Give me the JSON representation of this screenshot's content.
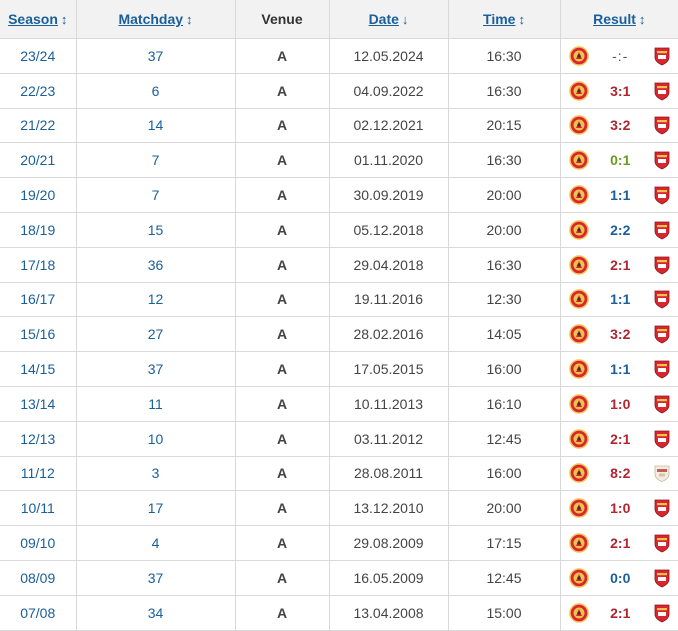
{
  "headers": {
    "season": "Season",
    "matchday": "Matchday",
    "venue": "Venue",
    "date": "Date",
    "time": "Time",
    "result": "Result"
  },
  "icons": {
    "sort_both": "sort-updown-icon",
    "sort_desc": "sort-down-icon",
    "home_crest": "manchester-united-crest-icon",
    "away_crest": "arsenal-crest-icon",
    "away_crest_alt": "arsenal-crest-old-icon"
  },
  "colors": {
    "link": "#1a5f9a",
    "loss": "#b0262e",
    "win": "#6a9a1f",
    "draw": "#1a5f9a",
    "header_bg": "#f2f2f2",
    "border": "#d9d9d9"
  },
  "rows": [
    {
      "season": "23/24",
      "matchday": "37",
      "venue": "A",
      "date": "12.05.2024",
      "time": "16:30",
      "result": "-:-",
      "outcome": "pending"
    },
    {
      "season": "22/23",
      "matchday": "6",
      "venue": "A",
      "date": "04.09.2022",
      "time": "16:30",
      "result": "3:1",
      "outcome": "loss"
    },
    {
      "season": "21/22",
      "matchday": "14",
      "venue": "A",
      "date": "02.12.2021",
      "time": "20:15",
      "result": "3:2",
      "outcome": "loss"
    },
    {
      "season": "20/21",
      "matchday": "7",
      "venue": "A",
      "date": "01.11.2020",
      "time": "16:30",
      "result": "0:1",
      "outcome": "win"
    },
    {
      "season": "19/20",
      "matchday": "7",
      "venue": "A",
      "date": "30.09.2019",
      "time": "20:00",
      "result": "1:1",
      "outcome": "draw"
    },
    {
      "season": "18/19",
      "matchday": "15",
      "venue": "A",
      "date": "05.12.2018",
      "time": "20:00",
      "result": "2:2",
      "outcome": "draw"
    },
    {
      "season": "17/18",
      "matchday": "36",
      "venue": "A",
      "date": "29.04.2018",
      "time": "16:30",
      "result": "2:1",
      "outcome": "loss"
    },
    {
      "season": "16/17",
      "matchday": "12",
      "venue": "A",
      "date": "19.11.2016",
      "time": "12:30",
      "result": "1:1",
      "outcome": "draw"
    },
    {
      "season": "15/16",
      "matchday": "27",
      "venue": "A",
      "date": "28.02.2016",
      "time": "14:05",
      "result": "3:2",
      "outcome": "loss"
    },
    {
      "season": "14/15",
      "matchday": "37",
      "venue": "A",
      "date": "17.05.2015",
      "time": "16:00",
      "result": "1:1",
      "outcome": "draw"
    },
    {
      "season": "13/14",
      "matchday": "11",
      "venue": "A",
      "date": "10.11.2013",
      "time": "16:10",
      "result": "1:0",
      "outcome": "loss"
    },
    {
      "season": "12/13",
      "matchday": "10",
      "venue": "A",
      "date": "03.11.2012",
      "time": "12:45",
      "result": "2:1",
      "outcome": "loss"
    },
    {
      "season": "11/12",
      "matchday": "3",
      "venue": "A",
      "date": "28.08.2011",
      "time": "16:00",
      "result": "8:2",
      "outcome": "loss",
      "alt_crest": true
    },
    {
      "season": "10/11",
      "matchday": "17",
      "venue": "A",
      "date": "13.12.2010",
      "time": "20:00",
      "result": "1:0",
      "outcome": "loss"
    },
    {
      "season": "09/10",
      "matchday": "4",
      "venue": "A",
      "date": "29.08.2009",
      "time": "17:15",
      "result": "2:1",
      "outcome": "loss"
    },
    {
      "season": "08/09",
      "matchday": "37",
      "venue": "A",
      "date": "16.05.2009",
      "time": "12:45",
      "result": "0:0",
      "outcome": "draw"
    },
    {
      "season": "07/08",
      "matchday": "34",
      "venue": "A",
      "date": "13.04.2008",
      "time": "15:00",
      "result": "2:1",
      "outcome": "loss"
    }
  ]
}
